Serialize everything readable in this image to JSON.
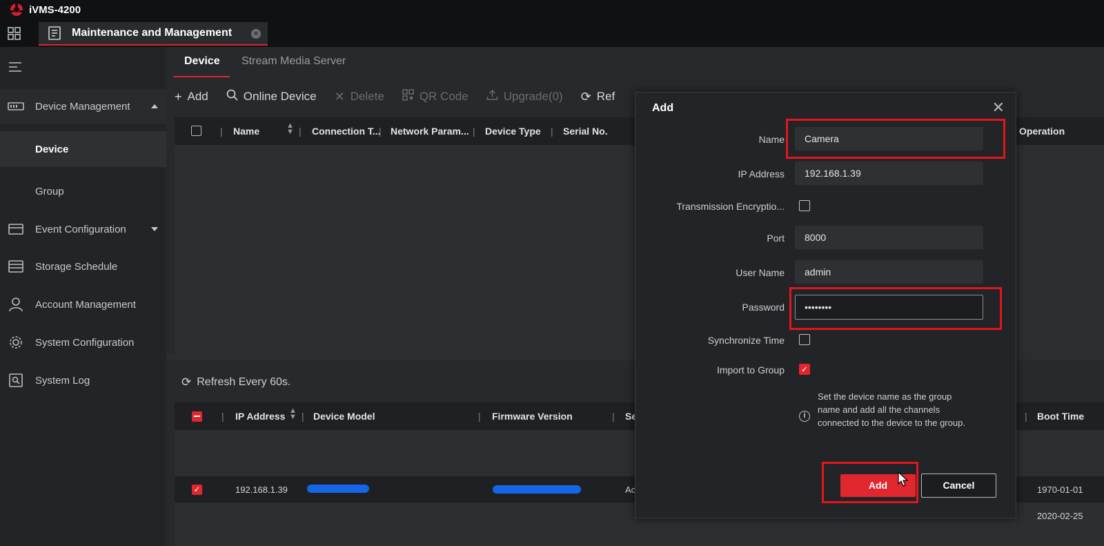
{
  "app": {
    "title": "iVMS-4200"
  },
  "tabbar": {
    "main_tab_label": "Maintenance and Management"
  },
  "sidebar": {
    "items": [
      {
        "label": "Device Management",
        "icon": "device-management-icon",
        "expanded": true
      },
      {
        "label": "Device",
        "active": true
      },
      {
        "label": "Group"
      },
      {
        "label": "Event Configuration",
        "icon": "event-configuration-icon"
      },
      {
        "label": "Storage Schedule",
        "icon": "storage-schedule-icon"
      },
      {
        "label": "Account Management",
        "icon": "account-icon"
      },
      {
        "label": "System Configuration",
        "icon": "gear-icon"
      },
      {
        "label": "System Log",
        "icon": "system-log-icon"
      }
    ]
  },
  "subtabs": [
    {
      "label": "Device",
      "active": true
    },
    {
      "label": "Stream Media Server",
      "active": false
    }
  ],
  "toolbar": {
    "add": "Add",
    "online_device": "Online Device",
    "delete": "Delete",
    "qr_code": "QR Code",
    "upgrade": "Upgrade(0)",
    "refresh": "Ref"
  },
  "device_table": {
    "columns": [
      "Name",
      "Connection T...",
      "Network Param...",
      "Device Type",
      "Serial No.",
      "Operation"
    ]
  },
  "online": {
    "refresh_label": "Refresh Every 60s.",
    "columns": [
      "IP Address",
      "Device Model",
      "Firmware Version",
      "Se",
      "Boot Time"
    ],
    "rows": [
      {
        "ip": "192.168.1.39",
        "security": "Ac",
        "boot_time": "1970-01-01",
        "selected": true
      },
      {
        "ip": "",
        "security": "",
        "boot_time": "2020-02-25",
        "selected": false
      }
    ]
  },
  "modal": {
    "title": "Add",
    "fields": {
      "name": {
        "label": "Name",
        "value": "Camera"
      },
      "ip": {
        "label": "IP Address",
        "value": "192.168.1.39"
      },
      "encryption": {
        "label": "Transmission Encryptio..."
      },
      "port": {
        "label": "Port",
        "value": "8000"
      },
      "user": {
        "label": "User Name",
        "value": "admin"
      },
      "password": {
        "label": "Password",
        "value": "••••••••"
      },
      "sync_time": {
        "label": "Synchronize Time"
      },
      "import_group": {
        "label": "Import to Group",
        "checked": true
      }
    },
    "info_text": "Set the device name as the group name and add all the channels connected to the device to the group.",
    "add_button": "Add",
    "cancel_button": "Cancel"
  },
  "colors": {
    "accent": "#e0262e",
    "highlight": "#e3151d",
    "redaction": "#1565e8"
  }
}
